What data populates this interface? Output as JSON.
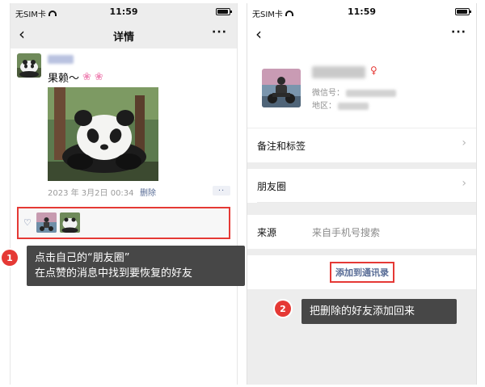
{
  "left_phone": {
    "status": {
      "carrier": "无SIM卡",
      "time": "11:59",
      "battery_fraction": 0.9
    },
    "nav": {
      "back_icon": "‹",
      "title": "详情",
      "more_icon": "···"
    },
    "post": {
      "text": "果赖～",
      "emojis": [
        "❀",
        "❀"
      ],
      "date": "2023 年 3月2日 00:34",
      "delete_label": "删除",
      "more_icon": "··"
    },
    "likes": {
      "heart_icon": "♡",
      "liker_count": 2
    }
  },
  "right_phone": {
    "status": {
      "carrier": "无SIM卡",
      "time": "11:59",
      "battery_fraction": 0.9
    },
    "nav": {
      "back_icon": "‹",
      "more_icon": "···"
    },
    "profile": {
      "gender_icon": "♀",
      "wechat_id_label": "微信号：",
      "region_label": "地区："
    },
    "rows": [
      {
        "label": "备注和标签",
        "chevron": "›"
      },
      {
        "label": "朋友圈",
        "chevron": "›"
      },
      {
        "label": "来源",
        "value": "来自手机号搜索"
      }
    ],
    "add_button": "添加到通讯录"
  },
  "callouts": [
    {
      "step": "1",
      "lines": [
        "点击自己的“朋友圈”",
        "在点赞的消息中找到要恢复的好友"
      ]
    },
    {
      "step": "2",
      "lines": [
        "把删除的好友添加回来"
      ]
    }
  ],
  "colors": {
    "accent_red": "#e53935",
    "link_blue": "#576b95",
    "callout_bg": "#474747"
  }
}
